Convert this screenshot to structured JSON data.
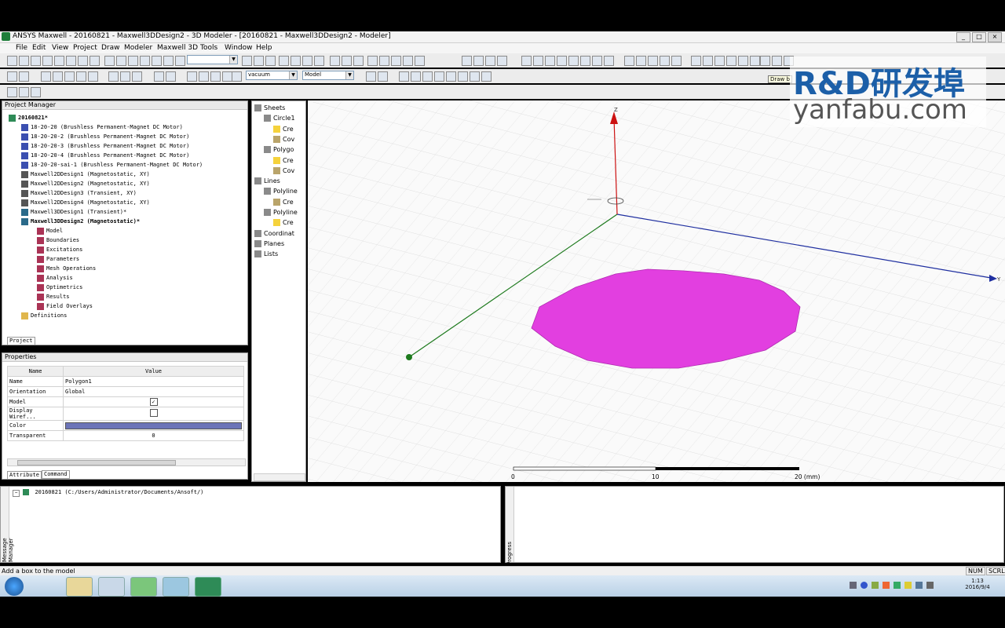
{
  "window": {
    "title": "ANSYS Maxwell - 20160821 - Maxwell3DDesign2 - 3D Modeler - [20160821 - Maxwell3DDesign2 - Modeler]",
    "min_label": "_",
    "max_label": "□",
    "close_label": "×"
  },
  "menu": [
    "File",
    "Edit",
    "View",
    "Project",
    "Draw",
    "Modeler",
    "Maxwell 3D",
    "Tools",
    "Window",
    "Help"
  ],
  "toolbar": {
    "material_select": "vacuum",
    "mode_select": "Model",
    "tooltip": "Draw b"
  },
  "project_manager": {
    "title": "Project Manager",
    "root": "20160821*",
    "items": [
      "18-20-20 (Brushless Permanent-Magnet DC Motor)",
      "18-20-20-2 (Brushless Permanent-Magnet DC Motor)",
      "18-20-20-3 (Brushless Permanent-Magnet DC Motor)",
      "18-20-20-4 (Brushless Permanent-Magnet DC Motor)",
      "18-20-20-sai-1 (Brushless Permanent-Magnet DC Motor)",
      "Maxwell2DDesign1 (Magnetostatic, XY)",
      "Maxwell2DDesign2 (Magnetostatic, XY)",
      "Maxwell2DDesign3 (Transient, XY)",
      "Maxwell2DDesign4 (Magnetostatic, XY)",
      "Maxwell3DDesign1 (Transient)*",
      "Maxwell3DDesign2 (Magnetostatic)*"
    ],
    "design_children": [
      "Model",
      "Boundaries",
      "Excitations",
      "Parameters",
      "Mesh Operations",
      "Analysis",
      "Optimetrics",
      "Results",
      "Field Overlays"
    ],
    "definitions": "Definitions",
    "tab": "Project"
  },
  "properties": {
    "title": "Properties",
    "col_name": "Name",
    "col_value": "Value",
    "rows": [
      {
        "name": "Name",
        "value": "Polygon1"
      },
      {
        "name": "Orientation",
        "value": "Global"
      },
      {
        "name": "Model",
        "value": "✓"
      },
      {
        "name": "Display Wiref...",
        "value": ""
      },
      {
        "name": "Color",
        "value": ""
      },
      {
        "name": "Transparent",
        "value": "0"
      }
    ],
    "color_hex": "#6c74b8",
    "tabs": [
      "Attribute",
      "Command"
    ]
  },
  "model_tree": {
    "items": [
      {
        "label": "Sheets",
        "indent": 0
      },
      {
        "label": "Circle1",
        "indent": 1
      },
      {
        "label": "Cre",
        "indent": 2
      },
      {
        "label": "Cov",
        "indent": 2
      },
      {
        "label": "Polygo",
        "indent": 1
      },
      {
        "label": "Cre",
        "indent": 2
      },
      {
        "label": "Cov",
        "indent": 2
      },
      {
        "label": "Lines",
        "indent": 0
      },
      {
        "label": "Polyline",
        "indent": 1
      },
      {
        "label": "Cre",
        "indent": 2
      },
      {
        "label": "Polyline",
        "indent": 1
      },
      {
        "label": "Cre",
        "indent": 2
      },
      {
        "label": "Coordinat",
        "indent": 0
      },
      {
        "label": "Planes",
        "indent": 0
      },
      {
        "label": "Lists",
        "indent": 0
      }
    ]
  },
  "viewport": {
    "axis_z": "Z",
    "axis_y": "Y",
    "scale_0": "0",
    "scale_10": "10",
    "scale_20": "20 (mm)",
    "polygon_color": "#e23fe0"
  },
  "watermark": {
    "brand": "R&D研发埠",
    "url": "yanfabu.com"
  },
  "message_manager": {
    "label": "Message Manager",
    "entry": "20160821 (C:/Users/Administrator/Documents/Ansoft/)"
  },
  "progress": {
    "label": "Progress"
  },
  "status": {
    "text": "Add a box to the model",
    "num": "NUM",
    "scrl": "SCRL"
  },
  "taskbar": {
    "time": "1:13",
    "date": "2016/9/4"
  }
}
